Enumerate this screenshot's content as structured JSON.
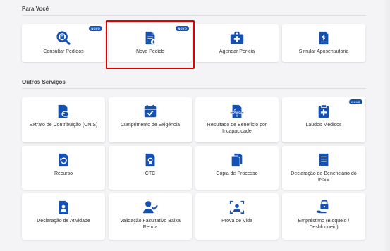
{
  "sections": {
    "para_voce": {
      "title": "Para Você"
    },
    "outros": {
      "title": "Outros Serviços"
    }
  },
  "badge_label": "NOVO",
  "colors": {
    "primary": "#1351b4",
    "highlight": "#e00000",
    "card_bg": "#ffffff",
    "page_bg": "#f4f4f6"
  },
  "para_voce_cards": [
    {
      "label": "Consultar Pedidos",
      "icon": "search-document-icon",
      "badge": true
    },
    {
      "label": "Novo Pedido",
      "icon": "new-document-icon",
      "badge": true
    },
    {
      "label": "Agendar Perícia",
      "icon": "medical-kit-icon",
      "badge": false
    },
    {
      "label": "Simular Aposentadoria",
      "icon": "document-money-icon",
      "badge": false
    }
  ],
  "outros_cards": [
    {
      "label": "Extrato de Contribuição (CNIS)",
      "icon": "document-piggy-bank-icon",
      "badge": false
    },
    {
      "label": "Cumprimento de Exigência",
      "icon": "calendar-check-icon",
      "badge": false
    },
    {
      "label": "Resultado de Benefício por Incapacidade",
      "icon": "document-pulse-icon",
      "badge": false
    },
    {
      "label": "Laudos Médicos",
      "icon": "medical-clipboard-icon",
      "badge": true
    },
    {
      "label": "Recurso",
      "icon": "document-undo-icon",
      "badge": false
    },
    {
      "label": "CTC",
      "icon": "document-certificate-icon",
      "badge": false
    },
    {
      "label": "Cópia de Processo",
      "icon": "copy-documents-icon",
      "badge": false
    },
    {
      "label": "Declaração de Beneficiário do INSS",
      "icon": "receipt-icon",
      "badge": false
    },
    {
      "label": "Declaração de Atividade",
      "icon": "document-user-icon",
      "badge": false
    },
    {
      "label": "Validação Facultativo Baixa Renda",
      "icon": "user-check-icon",
      "badge": false
    },
    {
      "label": "Prova de Vida",
      "icon": "face-scan-icon",
      "badge": false
    },
    {
      "label": "Empréstimo (Bloqueio / Desbloqueio)",
      "icon": "hand-coin-icon",
      "badge": false
    }
  ]
}
